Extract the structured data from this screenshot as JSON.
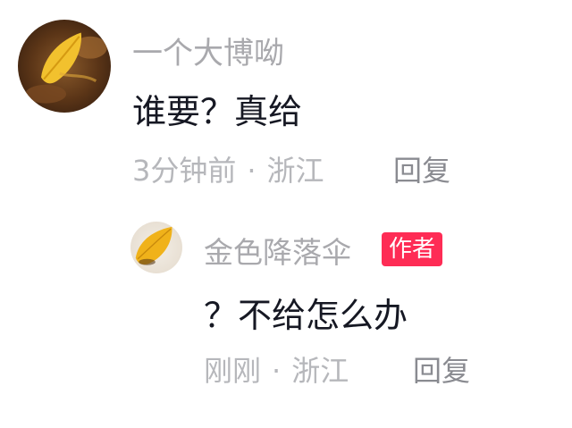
{
  "comments": [
    {
      "username": "一个大博呦",
      "text": "谁要？真给",
      "time": "3分钟前",
      "separator": "·",
      "location": "浙江",
      "reply_label": "回复",
      "avatar_icon": "yellow-leaf-avatar"
    },
    {
      "username": "金色降落伞",
      "badge": "作者",
      "text": "？不给怎么办",
      "time": "刚刚",
      "separator": "·",
      "location": "浙江",
      "reply_label": "回复",
      "avatar_icon": "yellow-leaf-avatar"
    }
  ],
  "colors": {
    "username": "#a9a9ad",
    "text": "#161823",
    "meta": "#b6b7bb",
    "reply": "#8a8b91",
    "badge_bg": "#fe2c55"
  }
}
